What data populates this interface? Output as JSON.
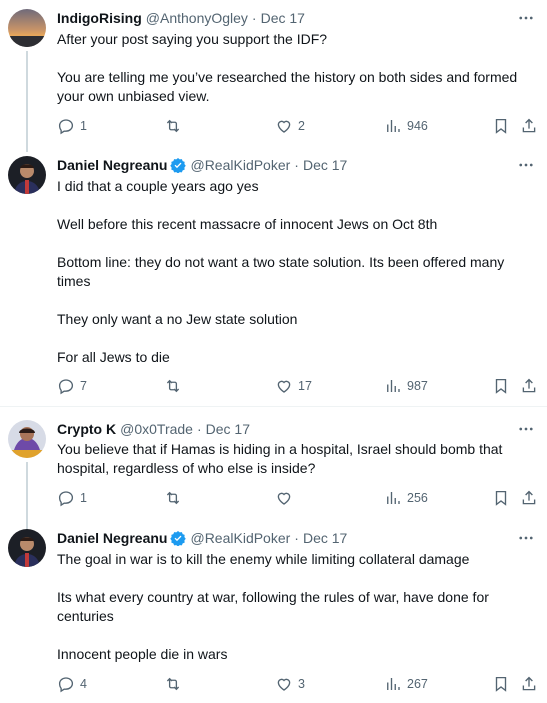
{
  "tweets": [
    {
      "name": "IndigoRising",
      "handle": "@AnthonyOgley",
      "sep": "·",
      "date": "Dec 17",
      "verified": false,
      "lines": [
        "After your post saying you support the IDF?",
        "",
        "You are telling me you’ve researched the history on both sides and formed your own unbiased view."
      ],
      "replies": "1",
      "retweets": "",
      "likes": "2",
      "views": "946"
    },
    {
      "name": "Daniel Negreanu",
      "handle": "@RealKidPoker",
      "sep": "·",
      "date": "Dec 17",
      "verified": true,
      "lines": [
        "I did that a couple years ago yes",
        "",
        "Well before this recent massacre of innocent Jews on Oct 8th",
        "",
        "Bottom line: they do not want a two state solution. Its been offered many times",
        "",
        "They only want a no Jew state solution",
        "",
        "For all Jews to die"
      ],
      "replies": "7",
      "retweets": "",
      "likes": "17",
      "views": "987"
    },
    {
      "name": "Crypto K",
      "handle": "@0x0Trade",
      "sep": "·",
      "date": "Dec 17",
      "verified": false,
      "lines": [
        "You believe that if Hamas is hiding in a hospital, Israel should bomb that hospital, regardless of who else is inside?"
      ],
      "replies": "1",
      "retweets": "",
      "likes": "",
      "views": "256"
    },
    {
      "name": "Daniel Negreanu",
      "handle": "@RealKidPoker",
      "sep": "·",
      "date": "Dec 17",
      "verified": true,
      "lines": [
        "The goal in war is to kill the enemy while limiting collateral damage",
        "",
        "Its what every country at war, following the rules of war, have done for centuries",
        "",
        "Innocent people die in wars"
      ],
      "replies": "4",
      "retweets": "",
      "likes": "3",
      "views": "267"
    }
  ],
  "icons": {
    "reply": "reply-icon",
    "retweet": "retweet-icon",
    "like": "heart-icon",
    "views": "views-icon",
    "bookmark": "bookmark-icon",
    "share": "share-icon",
    "more": "more-icon",
    "verified": "verified-badge-icon"
  },
  "colors": {
    "text": "#0f1419",
    "muted": "#536471",
    "verified": "#1d9bf0",
    "line": "#cfd9de"
  }
}
